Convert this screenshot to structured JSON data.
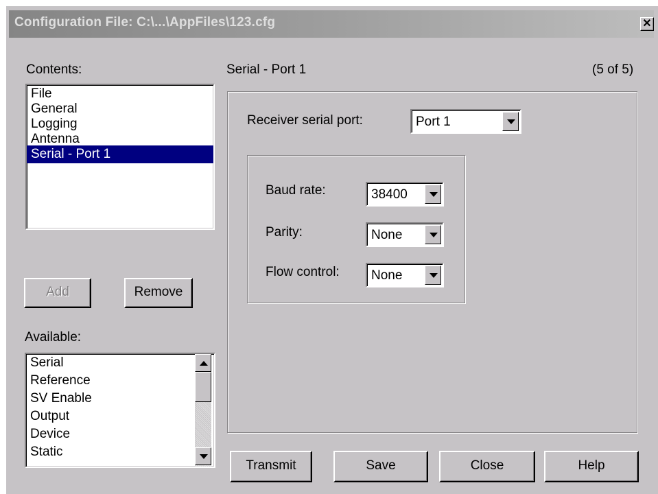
{
  "window": {
    "title": "Configuration File: C:\\...\\AppFiles\\123.cfg",
    "close_glyph": "✕"
  },
  "contents": {
    "label": "Contents:",
    "items": [
      "File",
      "General",
      "Logging",
      "Antenna",
      "Serial - Port 1"
    ],
    "selected": "Serial - Port 1"
  },
  "buttons": {
    "add": "Add",
    "remove": "Remove",
    "transmit": "Transmit",
    "save": "Save",
    "close": "Close",
    "help": "Help"
  },
  "available": {
    "label": "Available:",
    "items": [
      "Serial",
      "Reference",
      "SV Enable",
      "Output",
      "Device",
      "Static"
    ]
  },
  "panel": {
    "title": "Serial - Port 1",
    "page_indicator": "(5 of 5)",
    "receiver_port": {
      "label": "Receiver serial port:",
      "value": "Port 1"
    },
    "baud_rate": {
      "label": "Baud rate:",
      "value": "38400"
    },
    "parity": {
      "label": "Parity:",
      "value": "None"
    },
    "flow_control": {
      "label": "Flow control:",
      "value": "None"
    }
  },
  "colors": {
    "dialog_bg": "#c6c3c6",
    "selection": "#000080",
    "titlebar_text": "#dedede"
  },
  "icons": {
    "close": "close-icon",
    "dropdown": "chevron-down-icon",
    "scroll_up": "scroll-up-icon",
    "scroll_down": "scroll-down-icon"
  }
}
